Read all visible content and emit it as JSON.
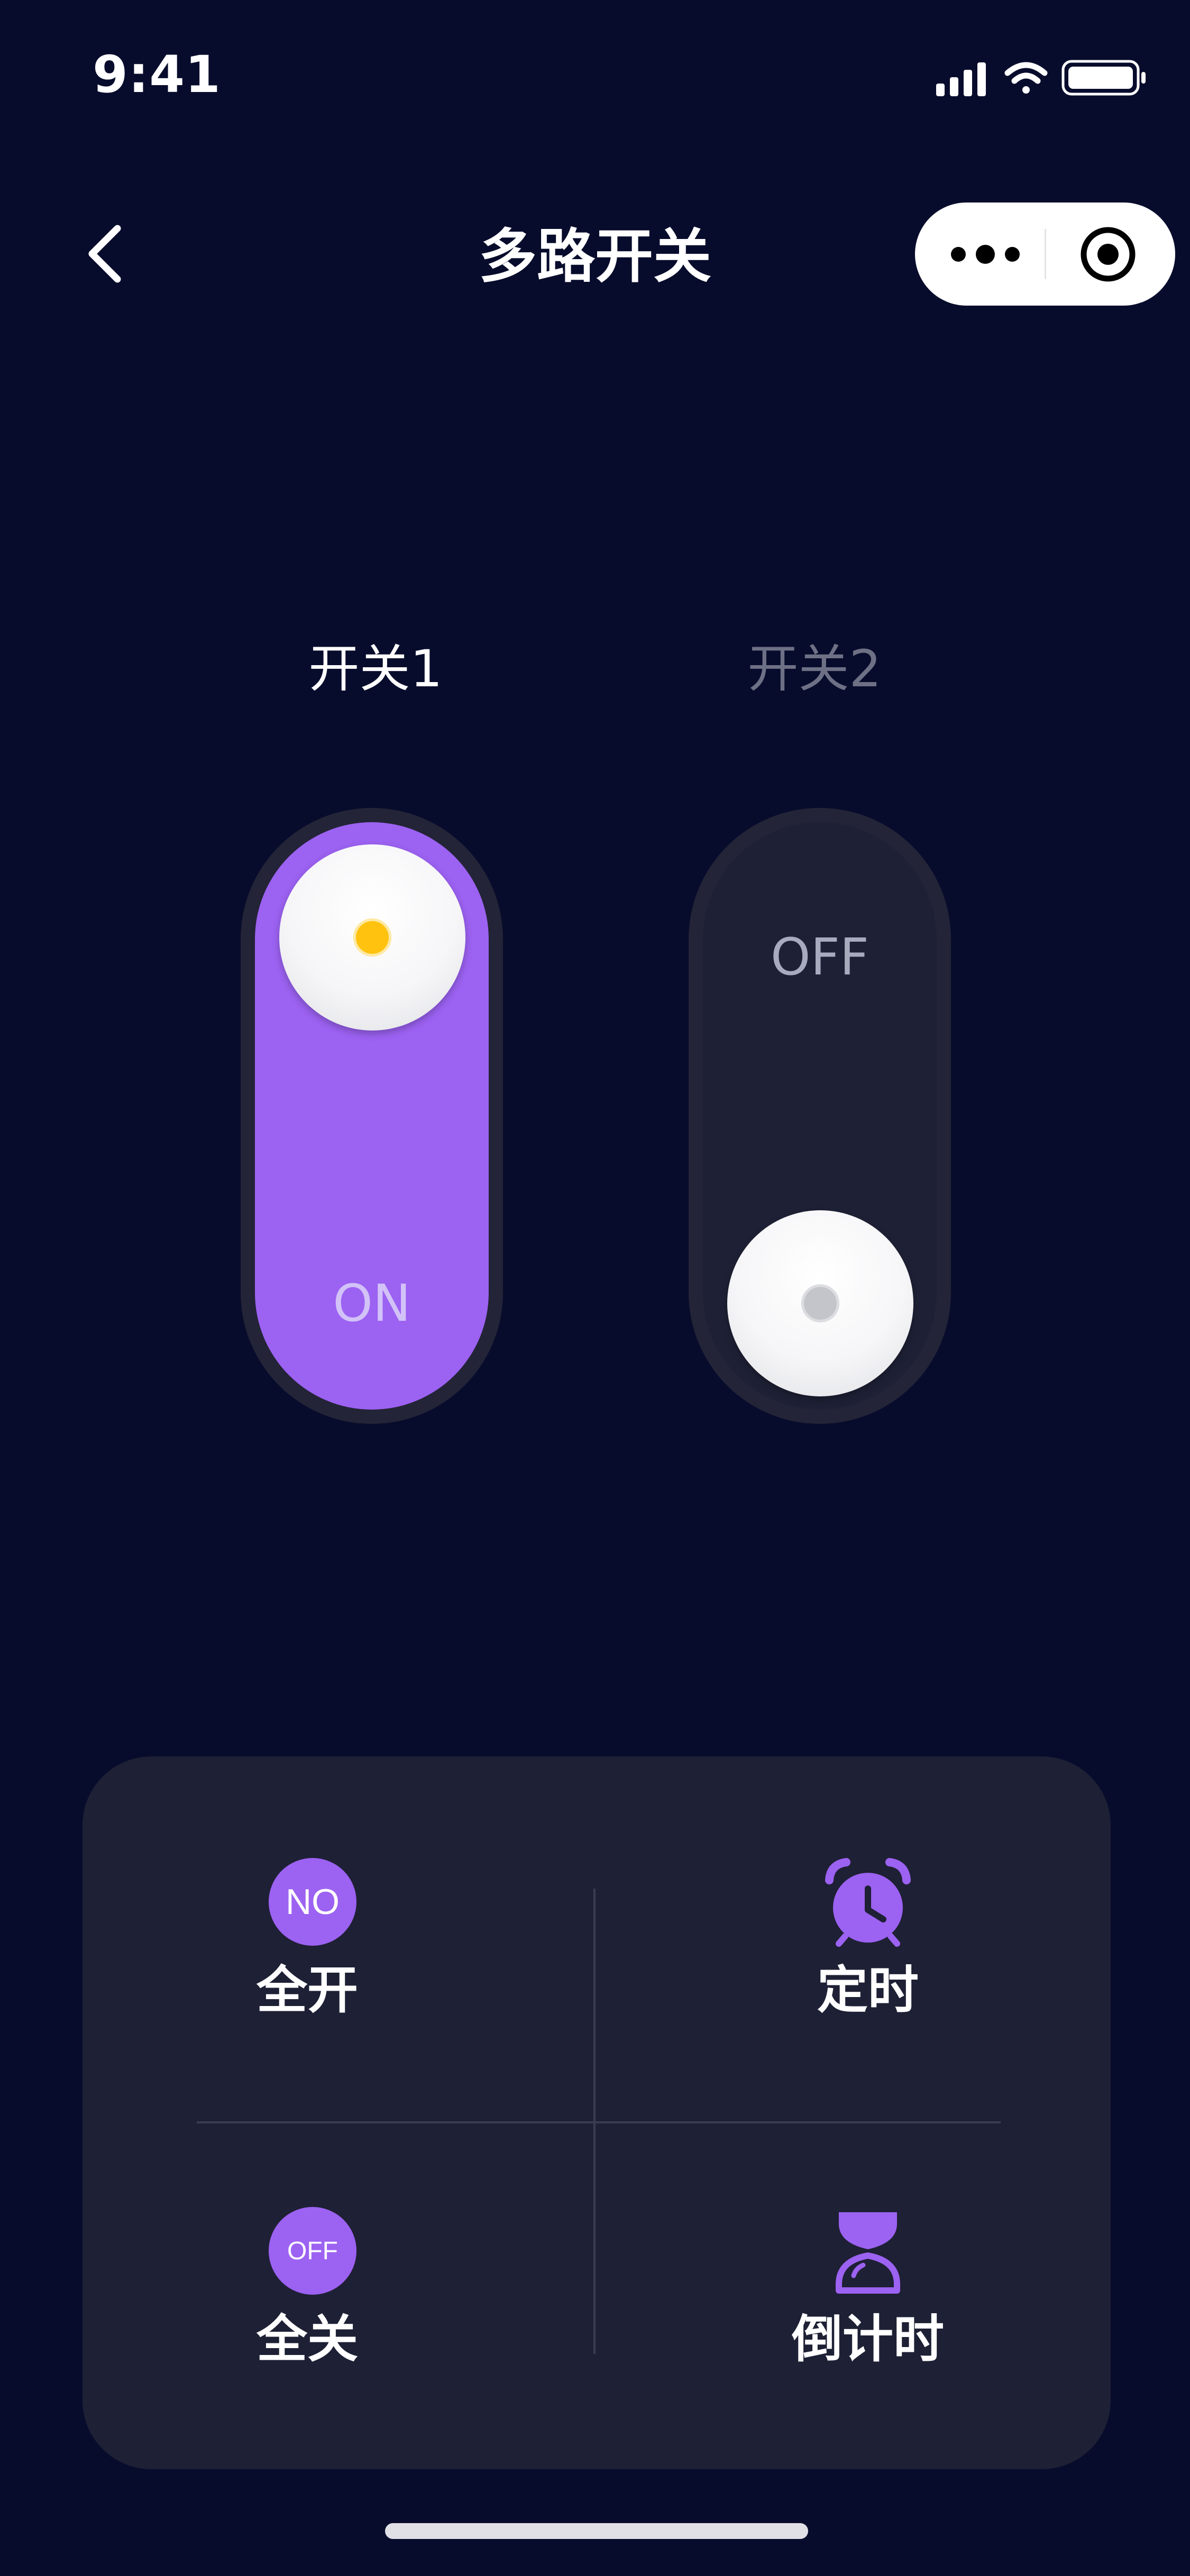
{
  "status_bar": {
    "time": "9:41"
  },
  "nav": {
    "title": "多路开关"
  },
  "switches": [
    {
      "label": "开关1",
      "state_text": "ON",
      "on": true
    },
    {
      "label": "开关2",
      "state_text": "OFF",
      "on": false
    }
  ],
  "panel": {
    "all_on": {
      "badge": "NO",
      "label": "全开"
    },
    "timer": {
      "label": "定时"
    },
    "all_off": {
      "badge": "OFF",
      "label": "全关"
    },
    "countdown": {
      "label": "倒计时"
    }
  },
  "colors": {
    "background": "#080c2c",
    "accent_purple": "#9c62f2",
    "panel_bg": "#1e2035",
    "indicator_yellow": "#ffc20e",
    "inactive_text": "#6e7185"
  },
  "icons": {
    "back": "chevron-left-icon",
    "more": "more-dots-icon",
    "close": "target-circle-icon",
    "timer": "alarm-clock-icon",
    "countdown": "hourglass-icon"
  }
}
